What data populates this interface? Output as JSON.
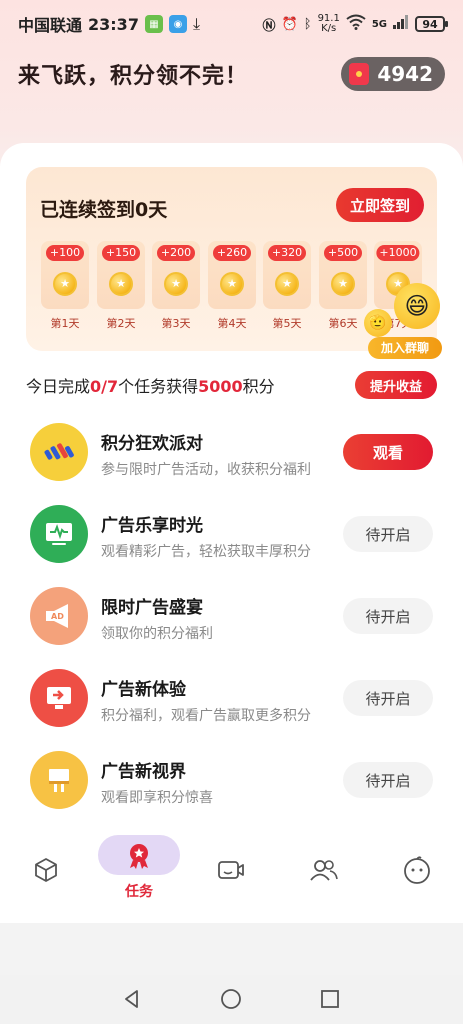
{
  "status_bar": {
    "carrier": "中国联通",
    "time": "23:37",
    "speed_value": "91.1",
    "speed_unit": "K/s",
    "network": "5G",
    "battery": "94"
  },
  "header": {
    "slogan": "来飞跃，积分领不完！",
    "points": "4942"
  },
  "signin": {
    "title": "已连续签到0天",
    "button": "立即签到",
    "days": [
      {
        "reward": "+100",
        "label": "第1天"
      },
      {
        "reward": "+150",
        "label": "第2天"
      },
      {
        "reward": "+200",
        "label": "第3天"
      },
      {
        "reward": "+260",
        "label": "第4天"
      },
      {
        "reward": "+320",
        "label": "第5天"
      },
      {
        "reward": "+500",
        "label": "第6天"
      },
      {
        "reward": "+1000",
        "label": "第7天"
      }
    ],
    "join_group": "加入群聊"
  },
  "summary": {
    "prefix": "今日完成",
    "progress": "0/7",
    "middle": "个任务获得",
    "points": "5000",
    "suffix": "积分",
    "boost_button": "提升收益"
  },
  "tasks": [
    {
      "title": "积分狂欢派对",
      "desc": "参与限时广告活动，收获积分福利",
      "button": "观看",
      "state": "active",
      "icon": "party-icon",
      "color": "#f6cf3b"
    },
    {
      "title": "广告乐享时光",
      "desc": "观看精彩广告，轻松获取丰厚积分",
      "button": "待开启",
      "state": "pending",
      "icon": "monitor-icon",
      "color": "#2fae57"
    },
    {
      "title": "限时广告盛宴",
      "desc": "领取你的积分福利",
      "button": "待开启",
      "state": "pending",
      "icon": "megaphone-icon",
      "color": "#f4a27b"
    },
    {
      "title": "广告新体验",
      "desc": "积分福利，观看广告赢取更多积分",
      "button": "待开启",
      "state": "pending",
      "icon": "screen-arrow-icon",
      "color": "#ee4f45"
    },
    {
      "title": "广告新视界",
      "desc": "观看即享积分惊喜",
      "button": "待开启",
      "state": "pending",
      "icon": "billboard-icon",
      "color": "#f7c244"
    }
  ],
  "bottom_nav": {
    "active_label": "任务",
    "items": [
      "cube-icon",
      "task-badge-icon",
      "video-icon",
      "group-icon",
      "face-icon"
    ]
  },
  "colors": {
    "accent_red": "#e2273a",
    "pending_bg": "#f3f3f3"
  }
}
